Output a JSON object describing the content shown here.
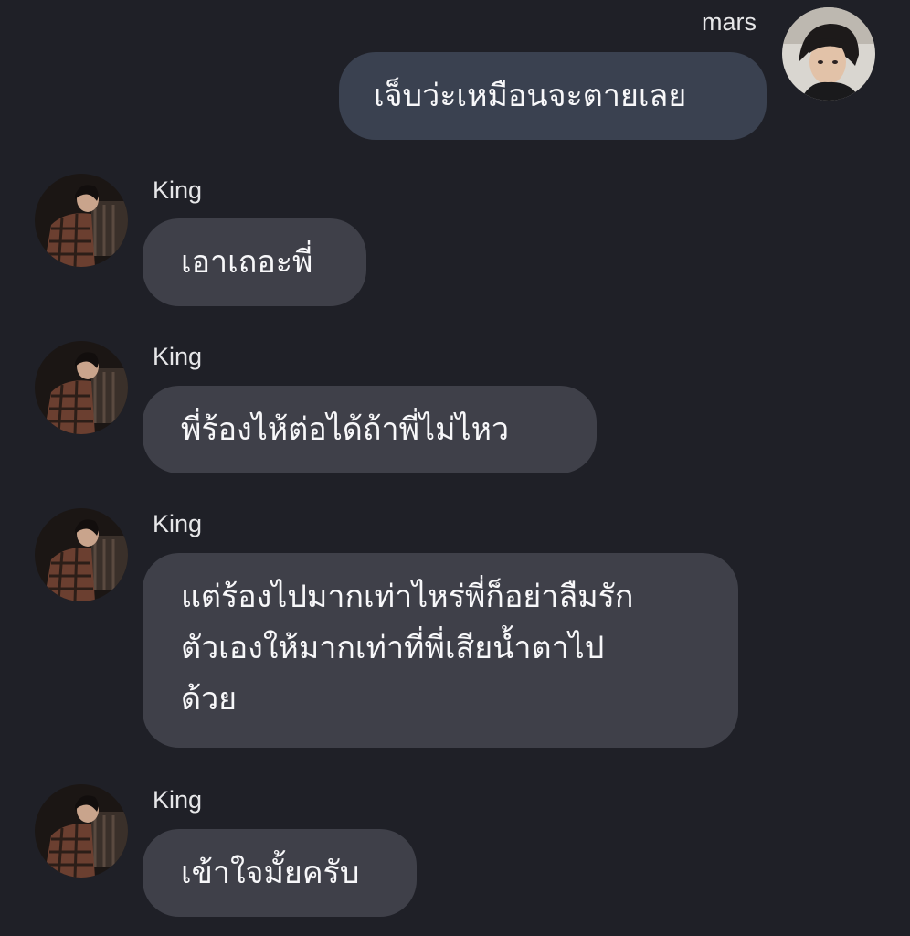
{
  "messages": [
    {
      "direction": "outgoing",
      "sender": "mars",
      "text": "เจ็บว่ะเหมือนจะตายเลย",
      "avatar": "avatar-mars"
    },
    {
      "direction": "incoming",
      "sender": "King",
      "text": "เอาเถอะพี่",
      "avatar": "avatar-king"
    },
    {
      "direction": "incoming",
      "sender": "King",
      "text": "พี่ร้องไห้ต่อได้ถ้าพี่ไม่ไหว",
      "avatar": "avatar-king"
    },
    {
      "direction": "incoming",
      "sender": "King",
      "text": "แต่ร้องไปมากเท่าไหร่พี่ก็อย่าลืมรัก\nตัวเองให้มากเท่าที่พี่เสียน้ำตาไป\nด้วย",
      "avatar": "avatar-king"
    },
    {
      "direction": "incoming",
      "sender": "King",
      "text": "เข้าใจมั้ยครับ",
      "avatar": "avatar-king"
    }
  ],
  "colors": {
    "background": "#1f2027",
    "outgoing_bubble": "#3a4150",
    "incoming_bubble": "#3f4049",
    "text": "#f7f7f9",
    "name": "#e6e6e8"
  }
}
